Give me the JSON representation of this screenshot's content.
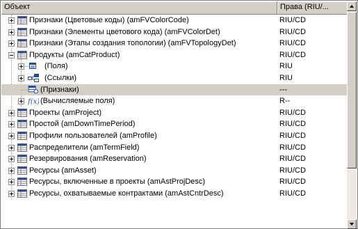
{
  "columns": {
    "object": "Объект",
    "rights": "Права (RIU/..."
  },
  "rows": [
    {
      "name": "Признаки (Цветовые коды) (amFVColorCode)",
      "rights": "RIU/CD"
    },
    {
      "name": "Признаки (Элементы цветового кода) (amFVColorDet)",
      "rights": "RIU/CD"
    },
    {
      "name": "Признаки (Этапы создания топологии) (amFVTopologyDet)",
      "rights": "RIU/CD"
    },
    {
      "name": "Продукты (amCatProduct)",
      "rights": "RIU/CD"
    },
    {
      "name": "(Поля)",
      "rights": "RIU"
    },
    {
      "name": "(Ссылки)",
      "rights": "RIU"
    },
    {
      "name": "(Признаки)",
      "rights": "---"
    },
    {
      "name": "(Вычисляемые поля)",
      "rights": "R--"
    },
    {
      "name": "Проекты (amProject)",
      "rights": "RIU/CD"
    },
    {
      "name": "Простой (amDownTimePeriod)",
      "rights": "RIU/CD"
    },
    {
      "name": "Профили пользователей (amProfile)",
      "rights": "RIU/CD"
    },
    {
      "name": "Распределители (amTermField)",
      "rights": "RIU/CD"
    },
    {
      "name": "Резервирования (amReservation)",
      "rights": "RIU/CD"
    },
    {
      "name": "Ресурсы (amAsset)",
      "rights": "RIU/CD"
    },
    {
      "name": "Ресурсы, включенные в проекты (amAstProjDesc)",
      "rights": "RIU/CD"
    },
    {
      "name": "Ресурсы, охватываемые контрактами (amAstCntrDesc)",
      "rights": "RIU/CD"
    }
  ],
  "colors": {
    "selected_row": "#d4d0c8",
    "header_bg": "#d4d0c8"
  },
  "icons": {
    "table": "table-icon",
    "fields": "fields-icon",
    "links": "links-icon",
    "features": "features-icon",
    "calc": "calc-fields-icon"
  }
}
